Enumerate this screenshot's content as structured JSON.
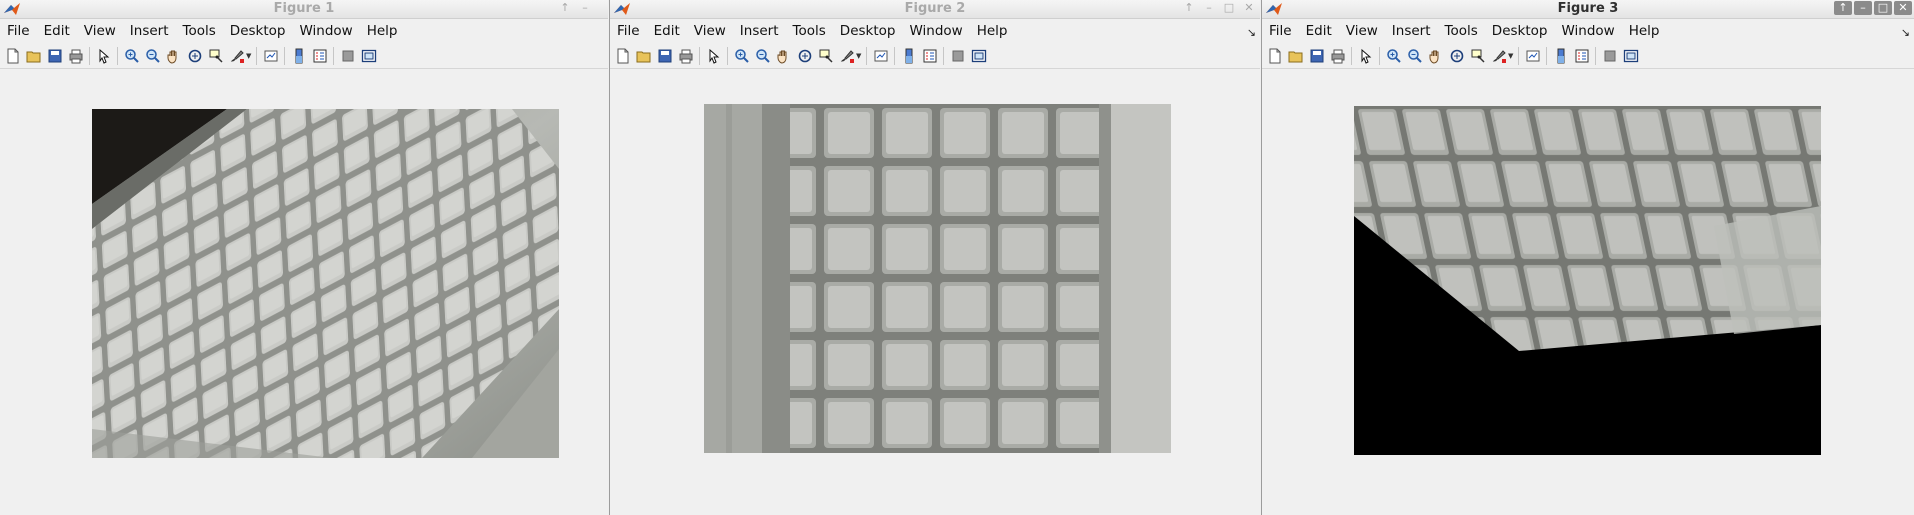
{
  "menu_items": [
    "File",
    "Edit",
    "View",
    "Insert",
    "Tools",
    "Desktop",
    "Window",
    "Help"
  ],
  "windows": [
    {
      "title": "Figure 1",
      "active": false,
      "controls": [
        "↑",
        "–"
      ]
    },
    {
      "title": "Figure 2",
      "active": false,
      "controls": [
        "↑",
        "–",
        "□",
        "✕"
      ]
    },
    {
      "title": "Figure 3",
      "active": true,
      "controls": [
        "↑",
        "–",
        "□",
        "✕"
      ]
    }
  ],
  "toolbar_icons": [
    "new-figure-icon",
    "open-file-icon",
    "save-icon",
    "print-icon",
    "edit-plot-arrow-icon",
    "zoom-in-icon",
    "zoom-out-icon",
    "pan-hand-icon",
    "rotate-3d-icon",
    "data-cursor-icon",
    "brush-icon",
    "link-plot-icon",
    "colorbar-icon",
    "legend-icon",
    "hide-plot-tools-icon",
    "show-plot-tools-icon"
  ],
  "colors": {
    "titlebar_inactive_text": "#a9a9a9",
    "titlebar_active_text": "#303030",
    "window_bg": "#f0f0f0",
    "image_black": "#000000",
    "keyboard_gray": "#b8b9b5"
  },
  "figure_images": [
    {
      "content": "photo-keyboard-angled"
    },
    {
      "content": "photo-keyboard-rotated-closeup"
    },
    {
      "content": "photo-keyboard-rectified-with-black-fill"
    }
  ]
}
